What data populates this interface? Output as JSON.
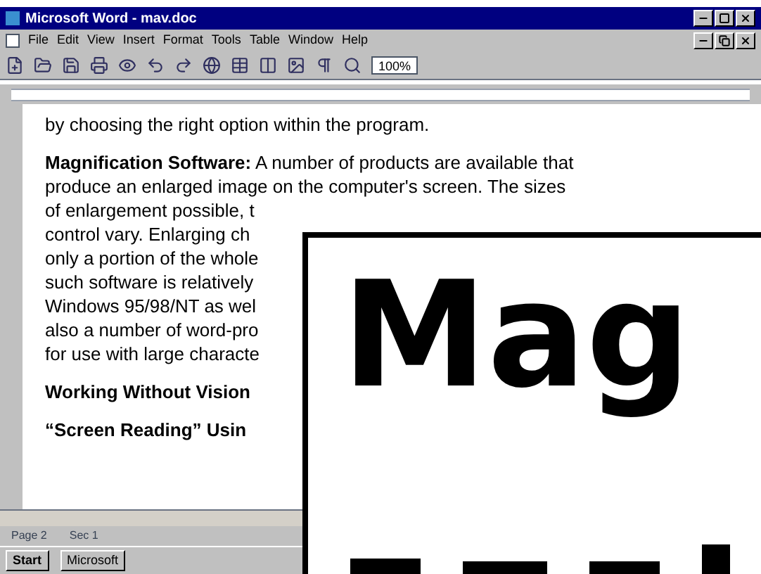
{
  "window": {
    "title": "Microsoft Word - mav.doc"
  },
  "menu": [
    "File",
    "Edit",
    "View",
    "Insert",
    "Format",
    "Tools",
    "Table",
    "Window",
    "Help"
  ],
  "toolbar": {
    "zoom": "100%"
  },
  "document": {
    "lines": [
      {
        "kind": "para",
        "text": "by choosing the right option within the program."
      },
      {
        "kind": "gap"
      },
      {
        "kind": "para",
        "text": "**Magnification Software:**  A number of products are available that"
      },
      {
        "kind": "para",
        "text": "produce an enlarged image on the computer's screen.  The sizes"
      },
      {
        "kind": "para",
        "text": "of enlargement possible, t"
      },
      {
        "kind": "para",
        "text": "control vary.  Enlarging ch"
      },
      {
        "kind": "para",
        "text": "only a portion of the whole"
      },
      {
        "kind": "para",
        "text": "such software is relatively"
      },
      {
        "kind": "para",
        "text": "Windows 95/98/NT as wel"
      },
      {
        "kind": "para",
        "text": "also a number of word-pro"
      },
      {
        "kind": "para",
        "text": "for use with large characte"
      },
      {
        "kind": "gap"
      },
      {
        "kind": "heading",
        "text": "Working Without Vision"
      },
      {
        "kind": "gap"
      },
      {
        "kind": "heading",
        "text": "“Screen Reading” Usin"
      }
    ]
  },
  "magnifier": {
    "text": "Mag"
  },
  "status_bar": [
    "Page 2",
    "Sec 1"
  ],
  "taskbar": {
    "start": "Start",
    "tasks": [
      "Microsoft"
    ]
  }
}
